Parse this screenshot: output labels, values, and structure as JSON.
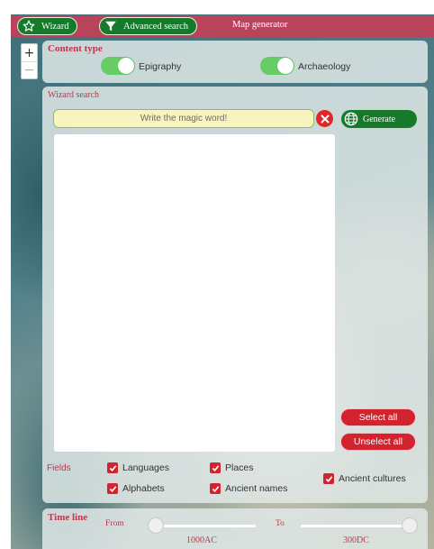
{
  "tabs": [
    {
      "label": "Wizard",
      "icon": "star-icon"
    },
    {
      "label": "Advanced search",
      "icon": "filter-icon"
    },
    {
      "label": "Map generator"
    }
  ],
  "zoom": {
    "in": "+",
    "out": "−"
  },
  "content_type": {
    "title": "Content type",
    "toggles": [
      {
        "label": "Epigraphy",
        "on": true
      },
      {
        "label": "Archaeology",
        "on": true
      }
    ]
  },
  "wizard": {
    "title": "Wizard search",
    "placeholder": "Write the magic word!",
    "generate_label": "Generate",
    "select_all": "Select all",
    "unselect_all": "Unselect all"
  },
  "fields": {
    "label": "Fields",
    "items": [
      {
        "label": "Languages",
        "checked": true
      },
      {
        "label": "Places",
        "checked": true
      },
      {
        "label": "Alphabets",
        "checked": true
      },
      {
        "label": "Ancient names",
        "checked": true
      },
      {
        "label": "Ancient cultures",
        "checked": true
      }
    ]
  },
  "timeline": {
    "title": "Time line",
    "from_label": "From",
    "to_label": "To",
    "from_value": "1000AC",
    "to_value": "300DC"
  },
  "colors": {
    "topbar": "#b7445a",
    "tab_green": "#157a2a",
    "accent_red": "#d3232f",
    "toggle_on": "#66cc66",
    "input_bg": "#f7f4bf"
  }
}
